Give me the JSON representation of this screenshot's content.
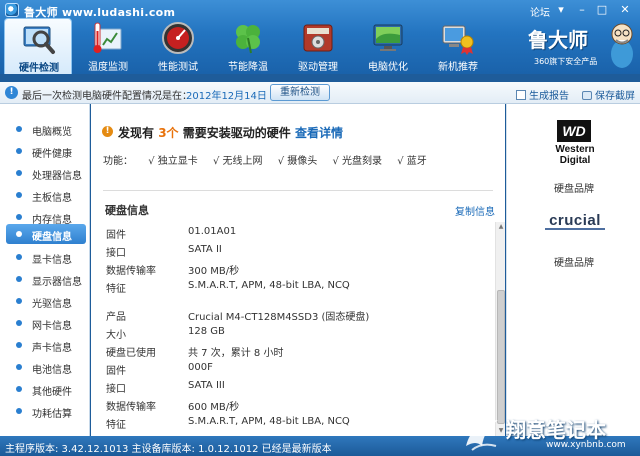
{
  "window": {
    "title": "鲁大师 www.ludashi.com",
    "forum": "论坛"
  },
  "nav": [
    {
      "label": "硬件检测",
      "icon": "magnifier-icon",
      "active": true
    },
    {
      "label": "温度监测",
      "icon": "thermometer-icon",
      "active": false
    },
    {
      "label": "性能测试",
      "icon": "speedometer-icon",
      "active": false
    },
    {
      "label": "节能降温",
      "icon": "clover-icon",
      "active": false
    },
    {
      "label": "驱动管理",
      "icon": "gear-box-icon",
      "active": false
    },
    {
      "label": "电脑优化",
      "icon": "monitor-icon",
      "active": false
    },
    {
      "label": "新机推荐",
      "icon": "computer-award-icon",
      "active": false
    }
  ],
  "brand": {
    "name": "鲁大师",
    "slogan": "360旗下安全产品"
  },
  "infobar": {
    "text": "最后一次检测电脑硬件配置情况是在：",
    "date": "2012年12月14日",
    "recheck": "重新检测",
    "report": "生成报告",
    "screenshot": "保存截屏"
  },
  "sidebar": [
    {
      "label": "电脑概览",
      "active": false
    },
    {
      "label": "硬件健康",
      "active": false
    },
    {
      "label": "处理器信息",
      "active": false
    },
    {
      "label": "主板信息",
      "active": false
    },
    {
      "label": "内存信息",
      "active": false
    },
    {
      "label": "硬盘信息",
      "active": true
    },
    {
      "label": "显卡信息",
      "active": false
    },
    {
      "label": "显示器信息",
      "active": false
    },
    {
      "label": "光驱信息",
      "active": false
    },
    {
      "label": "网卡信息",
      "active": false
    },
    {
      "label": "声卡信息",
      "active": false
    },
    {
      "label": "电池信息",
      "active": false
    },
    {
      "label": "其他硬件",
      "active": false
    },
    {
      "label": "功耗估算",
      "active": false
    }
  ],
  "main": {
    "found_prefix": "发现有",
    "found_count": "3个",
    "found_suffix": "需要安装驱动的硬件",
    "found_link": "查看详情",
    "functions_label": "功能：",
    "functions": [
      "√ 独立显卡",
      "√ 无线上网",
      "√ 摄像头",
      "√ 光盘刻录",
      "√ 蓝牙"
    ],
    "section_title": "硬盘信息",
    "copy": "复制信息",
    "rows": [
      {
        "label": "固件",
        "value": "01.01A01"
      },
      {
        "label": "接口",
        "value": "SATA II"
      },
      {
        "label": "数据传输率",
        "value": "300 MB/秒"
      },
      {
        "label": "特征",
        "value": "S.M.A.R.T, APM, 48-bit LBA, NCQ"
      },
      {
        "label": "产品",
        "value": "Crucial M4-CT128M4SSD3 (固态硬盘)"
      },
      {
        "label": "大小",
        "value": "128 GB"
      },
      {
        "label": "硬盘已使用",
        "value": "共 7 次，累计 8 小时"
      },
      {
        "label": "固件",
        "value": "000F"
      },
      {
        "label": "接口",
        "value": "SATA III"
      },
      {
        "label": "数据传输率",
        "value": "600 MB/秒"
      },
      {
        "label": "特征",
        "value": "S.M.A.R.T, APM, 48-bit LBA, NCQ"
      }
    ]
  },
  "right_panel": {
    "wd_badge": "WD",
    "wd_line1": "Western",
    "wd_line2": "Digital",
    "brand1_label": "硬盘品牌",
    "crucial_word": "crucial",
    "brand2_label": "硬盘品牌"
  },
  "status": {
    "text": "主程序版本: 3.42.12.1013    主设备库版本: 1.0.12.1012    已经是最新版本"
  },
  "watermark": {
    "main": "翔意笔记本",
    "sub": "www.xynbnb.com"
  },
  "colors": {
    "header_blue": "#2374c0",
    "accent_orange": "#e8720b",
    "link_blue": "#1a6ab8"
  }
}
